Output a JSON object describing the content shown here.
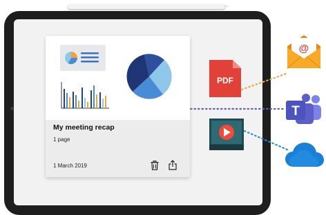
{
  "card": {
    "title": "My meeting recap",
    "pages": "1 page",
    "date": "1 March 2019"
  },
  "export_formats": [
    {
      "icon": "pdf-file-icon",
      "label": "PDF"
    },
    {
      "icon": "video-file-icon"
    }
  ],
  "targets": [
    {
      "icon": "email-icon",
      "symbol": "@"
    },
    {
      "icon": "teams-icon",
      "letter": "T"
    },
    {
      "icon": "cloud-icon"
    }
  ],
  "colors": {
    "pdf_red": "#e2413a",
    "email_orange": "#f7a928",
    "teams_purple": "#5b5fc7",
    "cloud_blue": "#1a7fd6",
    "video_teal": "#1f4a52",
    "dot_orange": "#f0a83a",
    "dot_purple": "#5b5fc7",
    "dot_blue": "#2a8be0"
  }
}
